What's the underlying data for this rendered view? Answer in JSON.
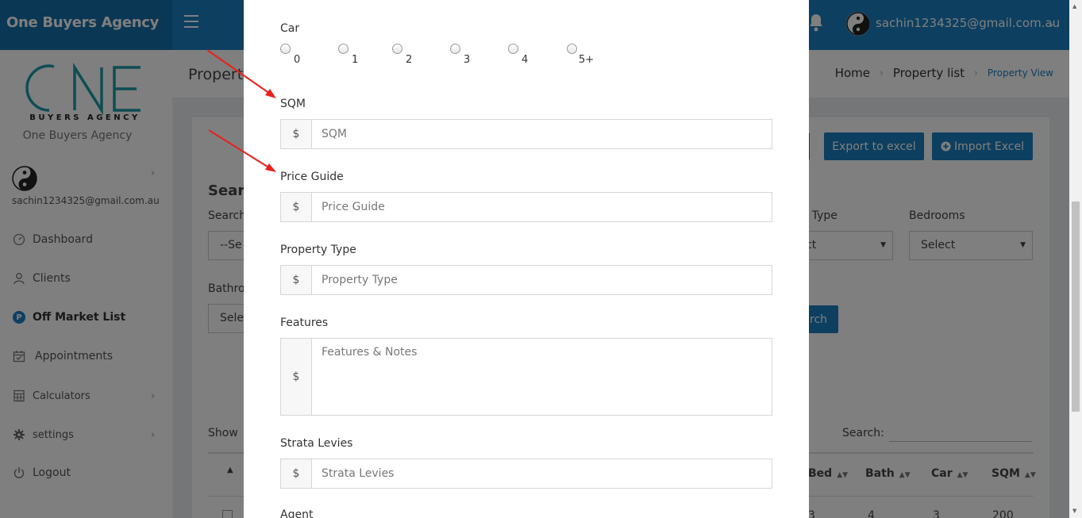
{
  "header": {
    "brand": "One Buyers Agency",
    "user_email": "sachin1234325@gmail.com.au"
  },
  "sidebar": {
    "logo_wordmark": "ONE",
    "logo_tagline": "BUYERS AGENCY",
    "org_name": "One Buyers Agency",
    "user_email": "sachin1234325@gmail.com.au",
    "items": [
      {
        "label": "Dashboard",
        "icon": "gauge-icon"
      },
      {
        "label": "Clients",
        "icon": "user-icon"
      },
      {
        "label": "Off Market List",
        "icon": "p-badge-icon",
        "active": true
      },
      {
        "label": "Appointments",
        "icon": "calendar-check-icon"
      },
      {
        "label": "Calculators",
        "icon": "calculator-icon",
        "has_children": true
      },
      {
        "label": "settings",
        "icon": "gear-icon",
        "has_children": true
      },
      {
        "label": "Logout",
        "icon": "power-icon"
      }
    ]
  },
  "page": {
    "title": "Property",
    "breadcrumb": [
      "Home",
      "Property list",
      "Property View"
    ]
  },
  "background": {
    "export_label": "Export to excel",
    "import_label": "Import Excel",
    "search_heading": "Searc",
    "search_label": "Search",
    "search_select_value": "--Se",
    "property_type_label": "y Type",
    "property_type_value": "ct",
    "bedrooms_label": "Bedrooms",
    "bedrooms_value": "Select",
    "bathrooms_label": "Bathro",
    "bathrooms_value": "Sele",
    "search_button": "rch",
    "show_label": "Show",
    "table_search_label": "Search:",
    "columns": [
      "Bed",
      "Bath",
      "Car",
      "SQM"
    ],
    "first_row": [
      "3",
      "4",
      "3",
      "200"
    ]
  },
  "modal": {
    "car_label": "Car",
    "car_options": [
      "0",
      "1",
      "2",
      "3",
      "4",
      "5+"
    ],
    "sqm": {
      "label": "SQM",
      "addon": "$",
      "placeholder": "SQM"
    },
    "price_guide": {
      "label": "Price Guide",
      "addon": "$",
      "placeholder": "Price Guide"
    },
    "property_type": {
      "label": "Property Type",
      "addon": "$",
      "placeholder": "Property Type"
    },
    "features": {
      "label": "Features",
      "addon": "$",
      "placeholder": "Features & Notes"
    },
    "strata_levies": {
      "label": "Strata Levies",
      "addon": "$",
      "placeholder": "Strata Levies"
    },
    "agent_label": "Agent"
  },
  "colors": {
    "primary": "#1a7fc1",
    "annotation_arrow": "#e8211c",
    "logo_teal": "#1b9aa8"
  }
}
